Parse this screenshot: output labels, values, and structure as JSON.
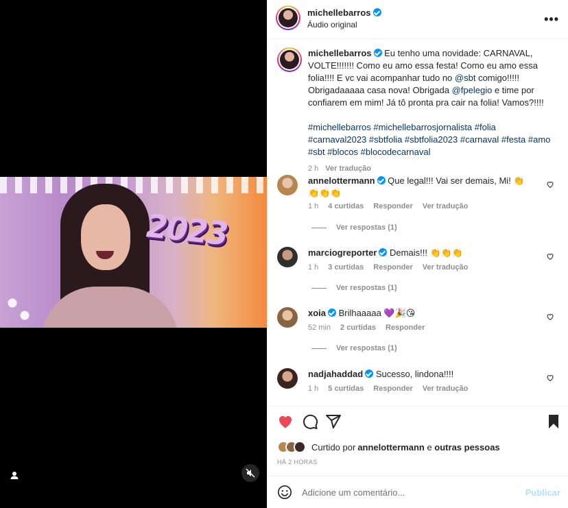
{
  "media": {
    "overlay_text": "2023",
    "user_icon": "person-icon",
    "mute_icon": "muted-speaker-icon"
  },
  "header": {
    "username": "michellebarros",
    "subtitle": "Áudio original",
    "more_icon": "more-horizontal-icon"
  },
  "caption": {
    "username": "michellebarros",
    "text_1": "Eu tenho uma novidade: CARNAVAL, VOLTE!!!!!!! Como eu amo essa festa! Como eu amo essa folia!!!! E vc vai acompanhar tudo no ",
    "mention_sbt": "@sbt",
    "text_2": " comigo!!!!! Obrigadaaaaa casa nova! Obrigada ",
    "mention_fpelegio": "@fpelegio",
    "text_3": " e time por confiarem em mim! Já tô pronta pra cair na folia! Vamos?!!!!",
    "hashtags": "#michellebarros #michellebarrosjornalista #folia #carnaval2023 #sbtfolia #sbtfolia2023 #carnaval #festa #amo #sbt #blocos #blocodecarnaval",
    "time": "2 h",
    "translate": "Ver tradução"
  },
  "comments": [
    {
      "username": "annelottermann",
      "text": "Que legal!!! Vai ser demais, Mi! 👏👏👏👏",
      "time": "1 h",
      "likes": "4 curtidas",
      "reply": "Responder",
      "translate": "Ver tradução",
      "view_replies": "Ver respostas (1)"
    },
    {
      "username": "marciogreporter",
      "text": "Demais!!! 👏👏👏",
      "time": "1 h",
      "likes": "3 curtidas",
      "reply": "Responder",
      "translate": "Ver tradução",
      "view_replies": "Ver respostas (1)"
    },
    {
      "username": "xoia",
      "text": "Brilhaaaaa 💜🎉😘",
      "time": "52 min",
      "likes": "2 curtidas",
      "reply": "Responder",
      "view_replies": "Ver respostas (1)"
    },
    {
      "username": "nadjahaddad",
      "text": "Sucesso, lindona!!!!",
      "time": "1 h",
      "likes": "5 curtidas",
      "reply": "Responder",
      "translate": "Ver tradução"
    }
  ],
  "actions": {
    "liked_prefix": "Curtido por ",
    "liked_user": "annelottermann",
    "liked_mid": " e ",
    "liked_others": "outras pessoas",
    "time_label": "HÁ 2 HORAS",
    "icons": [
      "heart-filled-icon",
      "comment-icon",
      "share-icon",
      "bookmark-icon"
    ]
  },
  "add_comment": {
    "placeholder": "Adicione um comentário...",
    "publish": "Publicar"
  },
  "colors": {
    "like_red": "#ed4956",
    "link_blue": "#00376b",
    "verified_blue": "#0095f6",
    "muted_gray": "#8e8e8e",
    "publish_disabled": "#b2dffc"
  }
}
